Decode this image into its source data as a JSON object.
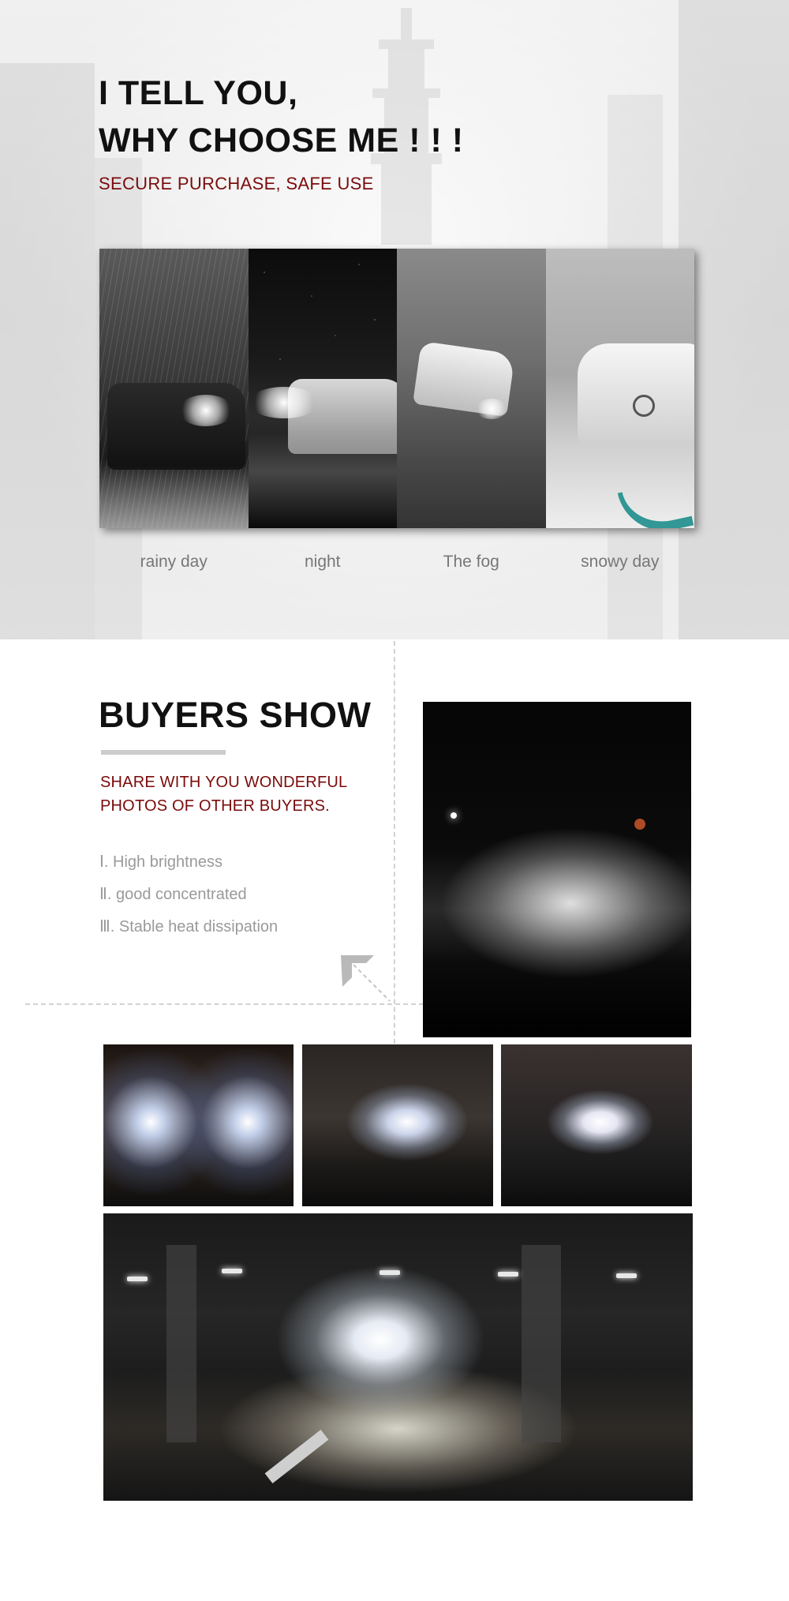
{
  "hero": {
    "title_line1": "I TELL YOU,",
    "title_line2": "WHY CHOOSE ME ! ! !",
    "subtitle": "SECURE PURCHASE, SAFE USE",
    "panels": [
      {
        "label": "rainy day"
      },
      {
        "label": "night"
      },
      {
        "label": "The fog"
      },
      {
        "label": "snowy day"
      }
    ]
  },
  "buyers_show": {
    "title": "BUYERS SHOW",
    "share_text": "SHARE WITH YOU WONDERFUL PHOTOS OF OTHER BUYERS.",
    "features": [
      "Ⅰ. High brightness",
      "Ⅱ. good concentrated",
      "Ⅲ. Stable heat dissipation"
    ]
  },
  "colors": {
    "accent_red": "#7a0b0b",
    "title_black": "#111111",
    "muted_gray": "#9a9a9a",
    "teal_swoosh": "#1e8e8c"
  }
}
